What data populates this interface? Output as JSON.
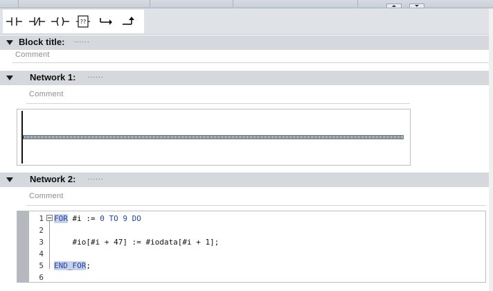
{
  "toolbar": {
    "buttons": [
      {
        "name": "normally-open-contact-icon"
      },
      {
        "name": "normally-closed-contact-icon"
      },
      {
        "name": "output-coil-icon"
      },
      {
        "name": "empty-box-icon",
        "label": "??"
      },
      {
        "name": "open-branch-icon"
      },
      {
        "name": "close-branch-icon"
      }
    ]
  },
  "block": {
    "title_label": "Block title:",
    "title_value": "......",
    "comment": "Comment"
  },
  "networks": [
    {
      "title": "Network 1:",
      "title_value": "......",
      "comment": "Comment"
    },
    {
      "title": "Network 2:",
      "title_value": "......",
      "comment": "Comment"
    }
  ],
  "scl": {
    "lines": [
      {
        "n": "1",
        "tokens": [
          {
            "t": "FOR",
            "c": "kw-hl"
          },
          {
            "t": " #i := ",
            "c": ""
          },
          {
            "t": "0",
            "c": "num"
          },
          {
            "t": " ",
            "c": ""
          },
          {
            "t": "TO",
            "c": "kw"
          },
          {
            "t": " ",
            "c": ""
          },
          {
            "t": "9",
            "c": "num"
          },
          {
            "t": " ",
            "c": ""
          },
          {
            "t": "DO",
            "c": "kw"
          }
        ]
      },
      {
        "n": "2",
        "tokens": []
      },
      {
        "n": "3",
        "tokens": [
          {
            "t": "    #io[#i + 47] := #iodata[#i + 1];",
            "c": ""
          }
        ]
      },
      {
        "n": "4",
        "tokens": []
      },
      {
        "n": "5",
        "tokens": [
          {
            "t": "END_FOR",
            "c": "kw-hl"
          },
          {
            "t": ";",
            "c": ""
          }
        ]
      },
      {
        "n": "6",
        "tokens": []
      }
    ]
  }
}
